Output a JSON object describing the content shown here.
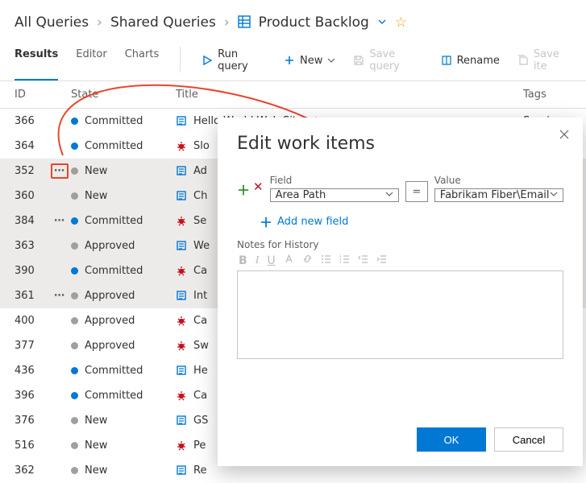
{
  "breadcrumb": {
    "root": "All Queries",
    "folder": "Shared Queries",
    "current": "Product Backlog"
  },
  "tabs": {
    "results": "Results",
    "editor": "Editor",
    "charts": "Charts"
  },
  "toolbar": {
    "run": "Run query",
    "new": "New",
    "save": "Save query",
    "rename": "Rename",
    "save_items": "Save ite"
  },
  "columns": {
    "id": "ID",
    "state": "State",
    "title": "Title",
    "tags": "Tags"
  },
  "states": {
    "committed": "Committed",
    "new": "New",
    "approved": "Approved"
  },
  "rows": [
    {
      "id": "366",
      "dot": "blue",
      "state": "committed",
      "kind": "pbi",
      "title": "Hello World Web Site",
      "tags": "Service"
    },
    {
      "id": "364",
      "dot": "blue",
      "state": "committed",
      "kind": "bug",
      "title": "Slo"
    },
    {
      "id": "352",
      "dot": "grey",
      "state": "new",
      "kind": "pbi",
      "title": "Ad",
      "menu": "boxed",
      "sel": true
    },
    {
      "id": "360",
      "dot": "grey",
      "state": "new",
      "kind": "pbi",
      "title": "Ch",
      "sel": true
    },
    {
      "id": "384",
      "dot": "blue",
      "state": "committed",
      "kind": "bug",
      "title": "Se",
      "menu": "plain",
      "sel": true
    },
    {
      "id": "363",
      "dot": "grey",
      "state": "approved",
      "kind": "pbi",
      "title": "We",
      "sel": true
    },
    {
      "id": "390",
      "dot": "blue",
      "state": "committed",
      "kind": "bug",
      "title": "Ca",
      "sel": true
    },
    {
      "id": "361",
      "dot": "grey",
      "state": "approved",
      "kind": "pbi",
      "title": "Int",
      "menu": "plain",
      "sel": true
    },
    {
      "id": "400",
      "dot": "grey",
      "state": "approved",
      "kind": "bug",
      "title": "Ca"
    },
    {
      "id": "377",
      "dot": "grey",
      "state": "approved",
      "kind": "bug",
      "title": "Sw"
    },
    {
      "id": "436",
      "dot": "blue",
      "state": "committed",
      "kind": "pbi",
      "title": "He"
    },
    {
      "id": "396",
      "dot": "blue",
      "state": "committed",
      "kind": "bug",
      "title": "Ca"
    },
    {
      "id": "376",
      "dot": "grey",
      "state": "new",
      "kind": "pbi",
      "title": "GS"
    },
    {
      "id": "516",
      "dot": "grey",
      "state": "new",
      "kind": "bug",
      "title": "Pe"
    },
    {
      "id": "362",
      "dot": "grey",
      "state": "new",
      "kind": "pbi",
      "title": "Re"
    }
  ],
  "dialog": {
    "title": "Edit work items",
    "field_label": "Field",
    "value_label": "Value",
    "field_value": "Area Path",
    "operator": "=",
    "value_value": "Fabrikam Fiber\\Email",
    "add_link": "Add new field",
    "notes_label": "Notes for History",
    "ok": "OK",
    "cancel": "Cancel"
  }
}
